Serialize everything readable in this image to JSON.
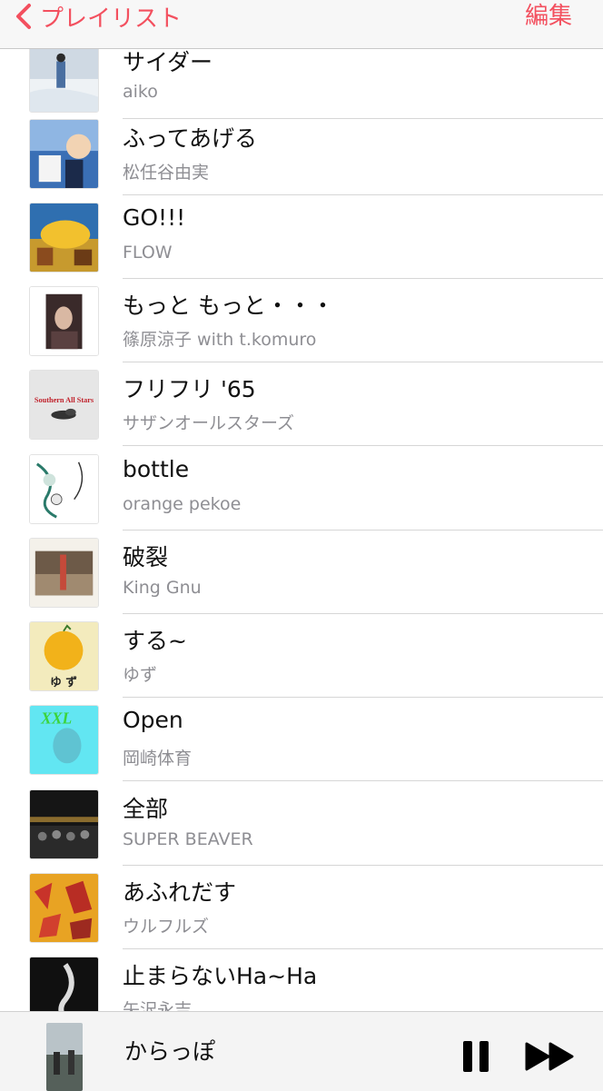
{
  "nav": {
    "back_label": "プレイリスト",
    "edit_label": "編集"
  },
  "accent_color": "#f3505f",
  "songs": [
    {
      "title": "サイダー",
      "artist": "aiko"
    },
    {
      "title": "ふってあげる",
      "artist": "松任谷由実"
    },
    {
      "title": "GO!!!",
      "artist": "FLOW"
    },
    {
      "title": "もっと もっと・・・",
      "artist": "篠原涼子 with t.komuro"
    },
    {
      "title": "フリフリ '65",
      "artist": "サザンオールスターズ"
    },
    {
      "title": "bottle",
      "artist": "orange pekoe"
    },
    {
      "title": "破裂",
      "artist": "King Gnu"
    },
    {
      "title": "する~",
      "artist": "ゆず"
    },
    {
      "title": "Open",
      "artist": "岡崎体育"
    },
    {
      "title": "全部",
      "artist": "SUPER BEAVER"
    },
    {
      "title": "あふれだす",
      "artist": "ウルフルズ"
    },
    {
      "title": "止まらないHa~Ha",
      "artist": "矢沢永吉"
    }
  ],
  "album_art_text": {
    "southern": "Southern All Stars",
    "yuzu": "ゆ ず",
    "xxl": "XXL"
  },
  "now_playing": {
    "title": "からっぽ",
    "pause_icon": "pause-icon",
    "next_icon": "fast-forward-icon"
  }
}
